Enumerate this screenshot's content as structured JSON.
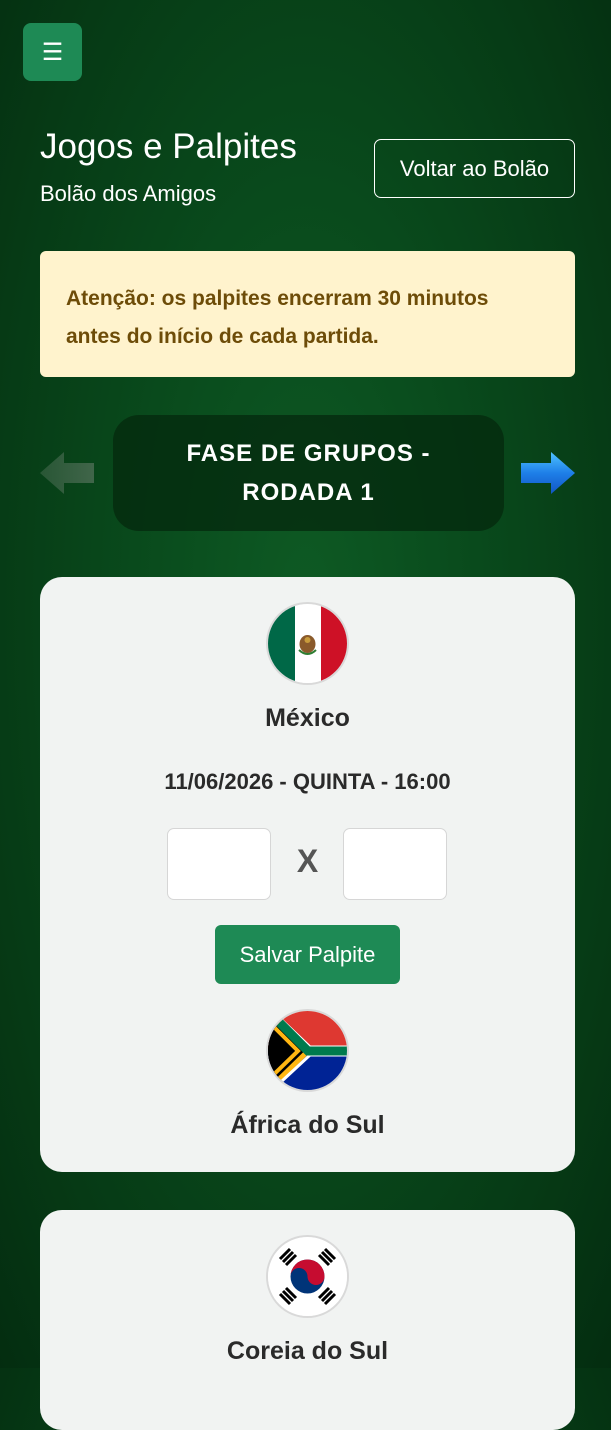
{
  "header": {
    "menu_icon": "☰",
    "title": "Jogos e Palpites",
    "subtitle": "Bolão dos Amigos",
    "back_label": "Voltar ao Bolão"
  },
  "alert": {
    "text": "Atenção: os palpites encerram 30 minutos antes do início de cada partida."
  },
  "round": {
    "title": "FASE DE GRUPOS - RODADA 1",
    "prev_icon": "arrow-left-icon",
    "next_icon": "arrow-right-icon"
  },
  "matches": [
    {
      "home": {
        "name": "México",
        "flag": "mexico-flag-icon"
      },
      "away": {
        "name": "África do Sul",
        "flag": "south-africa-flag-icon"
      },
      "datetime": "11/06/2026 - QUINTA - 16:00",
      "vs": "X",
      "home_score": "",
      "away_score": "",
      "save_label": "Salvar Palpite"
    },
    {
      "home": {
        "name": "Coreia do Sul",
        "flag": "south-korea-flag-icon"
      }
    }
  ],
  "colors": {
    "primary": "#1e8a55",
    "alert_bg": "#fff3cd",
    "alert_text": "#6d4c08",
    "card_bg": "#f1f3f2",
    "next_arrow": "#1e7fe8"
  }
}
